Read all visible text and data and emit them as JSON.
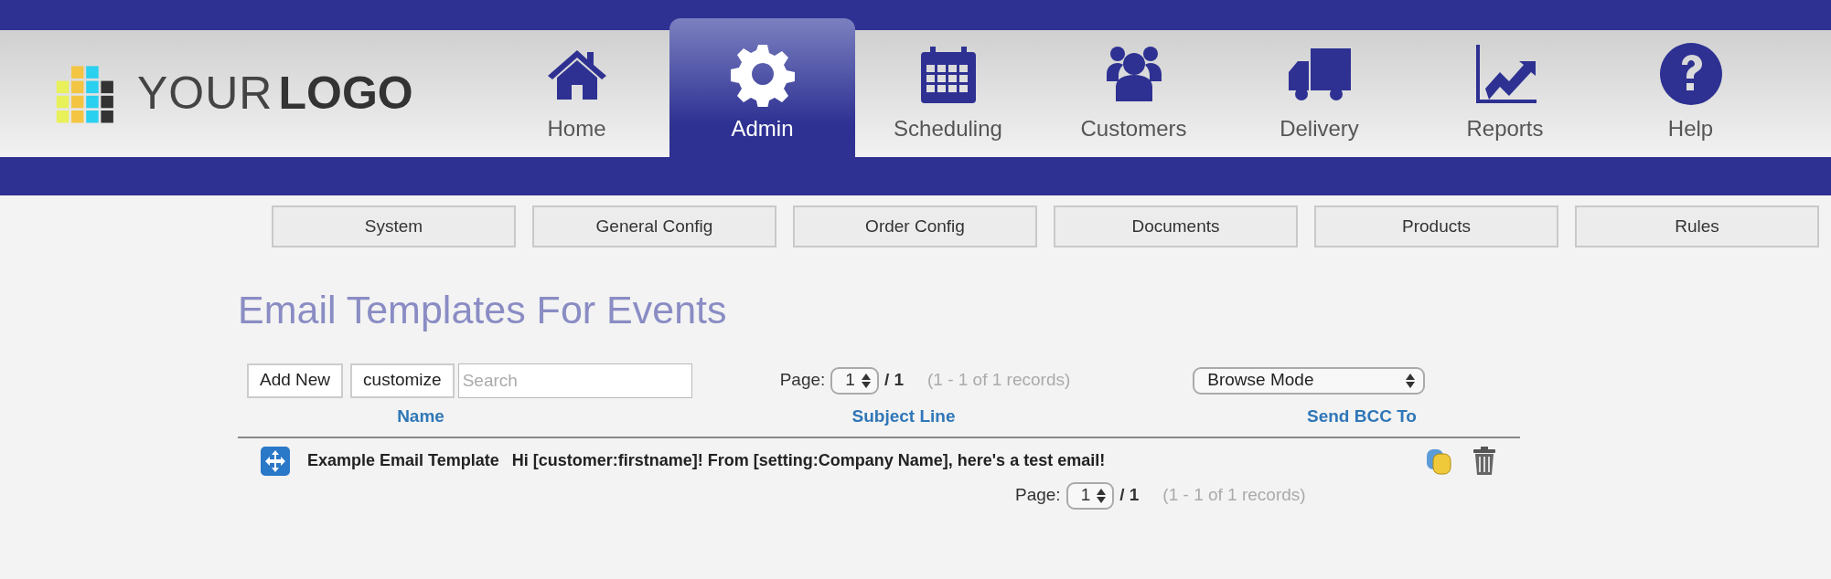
{
  "logo": {
    "text_light": "YOUR",
    "text_bold": "LOGO"
  },
  "nav": [
    {
      "label": "Home",
      "kind": "home",
      "selected": false
    },
    {
      "label": "Admin",
      "kind": "gear",
      "selected": true
    },
    {
      "label": "Scheduling",
      "kind": "calendar",
      "selected": false
    },
    {
      "label": "Customers",
      "kind": "people",
      "selected": false
    },
    {
      "label": "Delivery",
      "kind": "truck",
      "selected": false
    },
    {
      "label": "Reports",
      "kind": "chart",
      "selected": false
    },
    {
      "label": "Help",
      "kind": "help",
      "selected": false
    }
  ],
  "subnav": [
    "System",
    "General Config",
    "Order Config",
    "Documents",
    "Products",
    "Rules"
  ],
  "page_title": "Email Templates For Events",
  "toolbar": {
    "buttons": [
      "Add New",
      "customize"
    ],
    "search": {
      "placeholder": "Search"
    },
    "mode_select": "Browse Mode"
  },
  "pagers": [
    {
      "label": "Page:",
      "page": "1",
      "total": "/ 1",
      "records": "(1 - 1 of 1 records)"
    },
    {
      "label": "Page:",
      "page": "1",
      "total": "/ 1",
      "records": "(1 - 1 of 1 records)"
    }
  ],
  "table": {
    "columns": [
      "Name",
      "Subject Line",
      "Send BCC To"
    ],
    "rows": [
      {
        "name": "Example Email Template",
        "subject": "Hi [customer:firstname]! From [setting:Company Name], here's a test email!"
      }
    ]
  }
}
